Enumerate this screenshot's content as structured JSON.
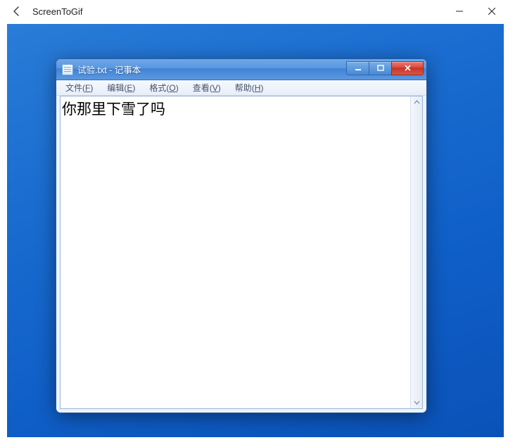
{
  "outer": {
    "title": "ScreenToGif"
  },
  "notepad": {
    "title": "试验.txt - 记事本",
    "menus": {
      "file": {
        "label": "文件",
        "accel": "F"
      },
      "edit": {
        "label": "编辑",
        "accel": "E"
      },
      "format": {
        "label": "格式",
        "accel": "O"
      },
      "view": {
        "label": "查看",
        "accel": "V"
      },
      "help": {
        "label": "帮助",
        "accel": "H"
      }
    },
    "content": "你那里下雪了吗"
  }
}
